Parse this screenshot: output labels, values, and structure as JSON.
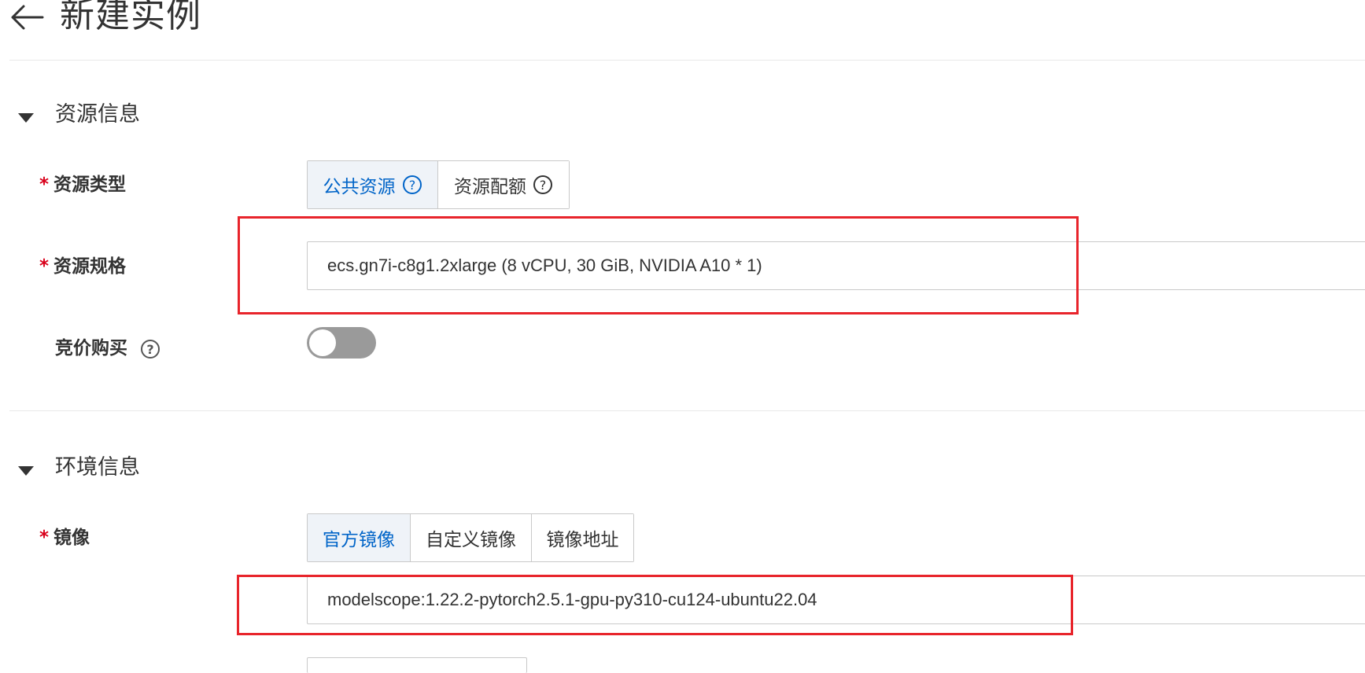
{
  "header": {
    "title": "新建实例"
  },
  "sections": {
    "resource": {
      "title": "资源信息",
      "resource_type": {
        "label": "资源类型",
        "options": [
          "公共资源",
          "资源配额"
        ],
        "selected": "公共资源"
      },
      "resource_spec": {
        "label": "资源规格",
        "value": "ecs.gn7i-c8g1.2xlarge  (8 vCPU, 30 GiB, NVIDIA A10 * 1)"
      },
      "bidding": {
        "label": "竞价购买",
        "enabled": false
      }
    },
    "environment": {
      "title": "环境信息",
      "image": {
        "label": "镜像",
        "options": [
          "官方镜像",
          "自定义镜像",
          "镜像地址"
        ],
        "selected": "官方镜像",
        "value": "modelscope:1.22.2-pytorch2.5.1-gpu-py310-cu124-ubuntu22.04"
      }
    }
  },
  "colors": {
    "accent": "#0064c8",
    "active_bg": "#eff3f8",
    "required": "#d9001b",
    "highlight": "#e8242b",
    "toggle_off": "#9a9a9a"
  },
  "icons": {
    "back": "arrow-left-icon",
    "collapse": "caret-down-icon",
    "help": "question-circle-icon"
  }
}
